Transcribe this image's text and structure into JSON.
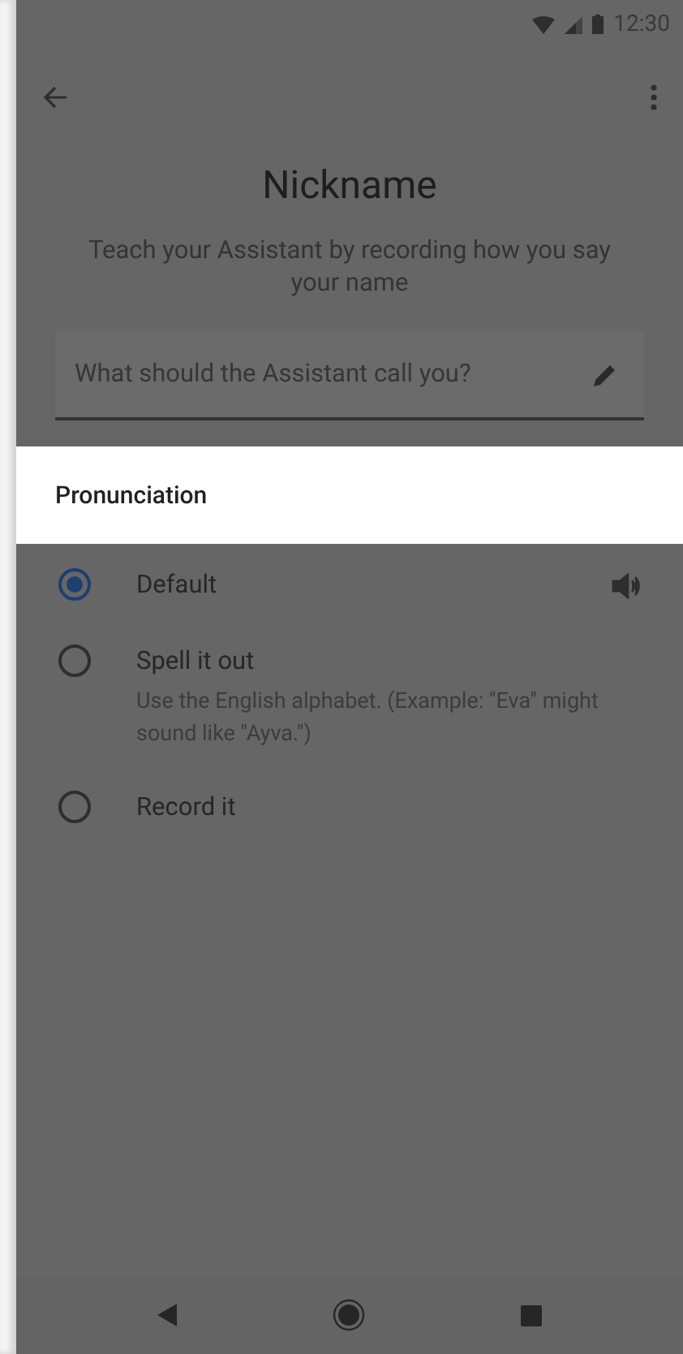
{
  "status_bar": {
    "time": "12:30"
  },
  "header": {
    "title": "Nickname",
    "subtitle": "Teach your Assistant by recording how you say your name"
  },
  "name_field": {
    "placeholder": "What should the Assistant call you?"
  },
  "section": {
    "title": "Pronunciation"
  },
  "options": [
    {
      "kind": "audio",
      "label": "Default",
      "selected": true
    },
    {
      "kind": "plain",
      "label": "Spell it out",
      "description": "Use the English alphabet. (Example: \"Eva\" might sound like \"Ayva.\")",
      "selected": false
    },
    {
      "kind": "plain",
      "label": "Record it",
      "selected": false
    }
  ]
}
